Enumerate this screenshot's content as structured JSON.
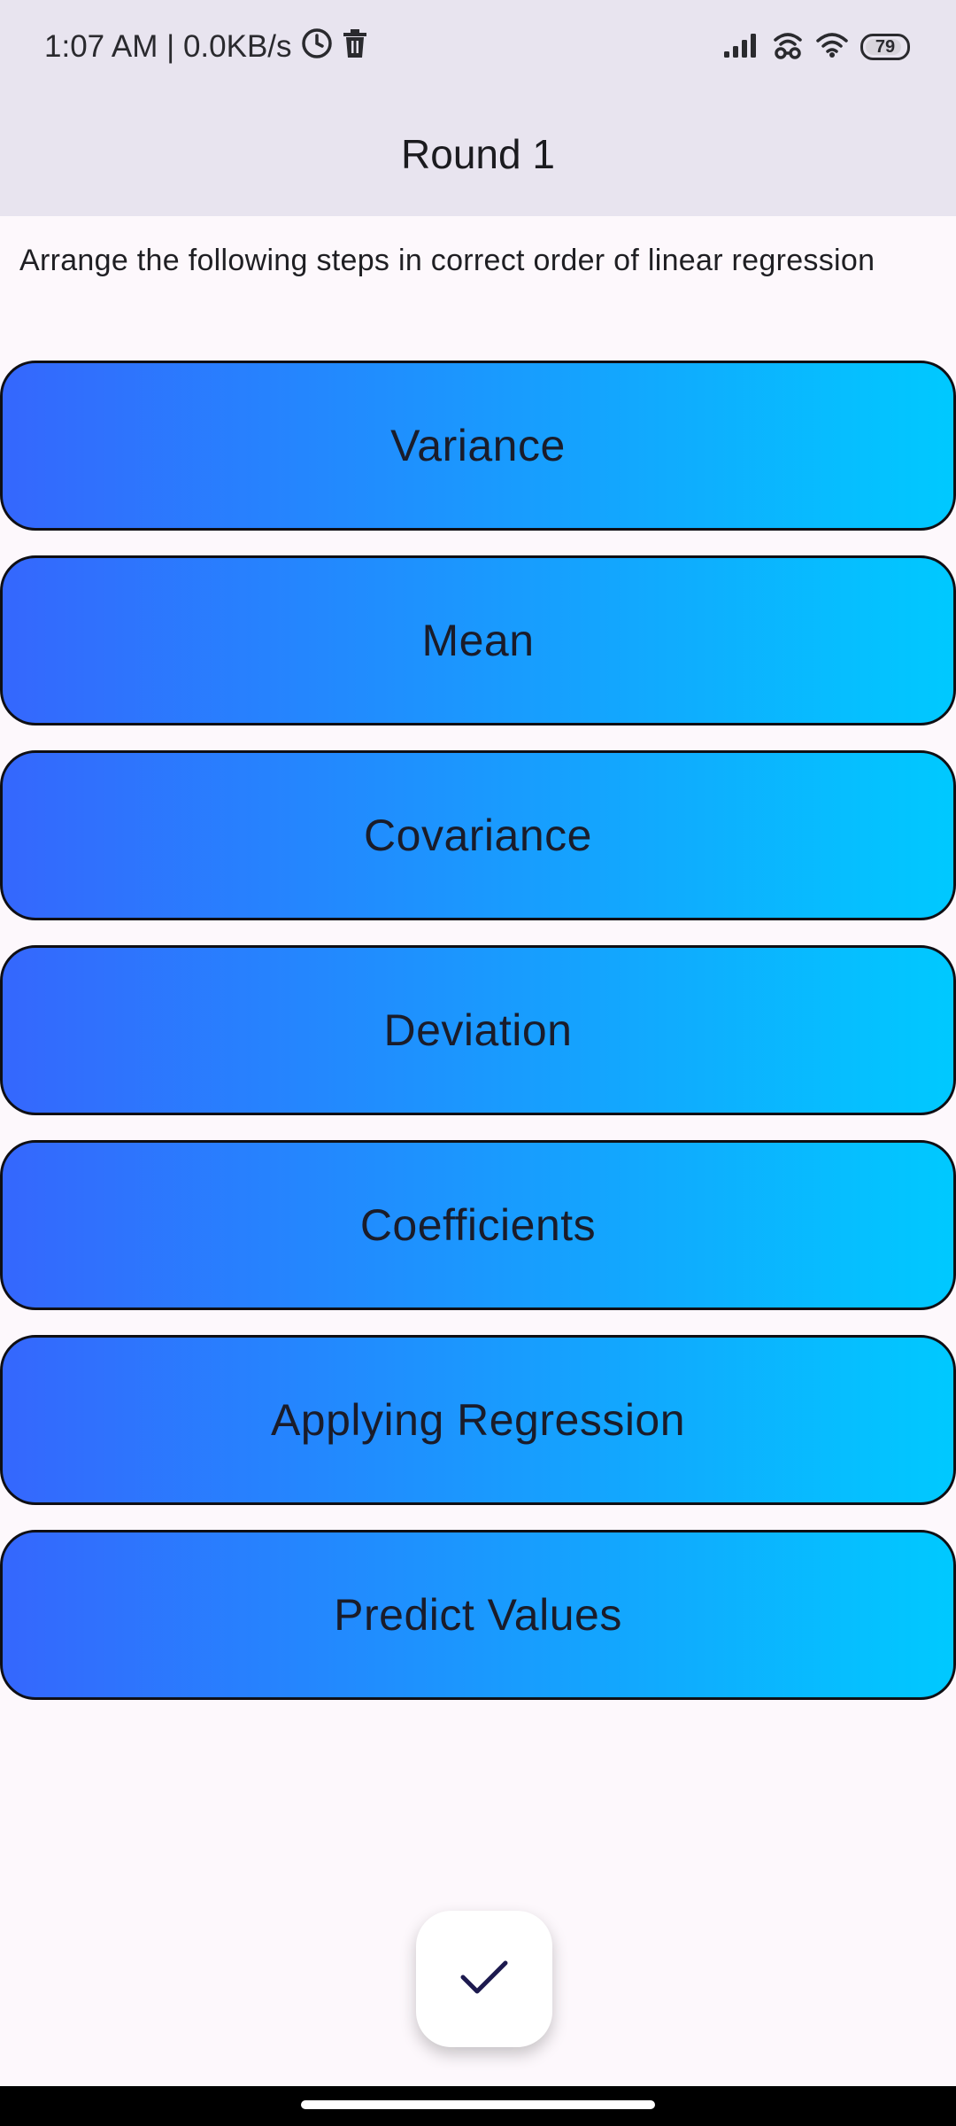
{
  "status_bar": {
    "time_speed": "1:07 AM | 0.0KB/s",
    "battery_level": "79",
    "icons": [
      "clock-icon",
      "trash-icon",
      "signal-icon",
      "hotspot-icon",
      "wifi-icon",
      "battery-icon"
    ]
  },
  "app_bar": {
    "title": "Round 1"
  },
  "question": {
    "text": "Arrange the following steps in correct order of linear regression"
  },
  "steps": [
    {
      "label": "Variance"
    },
    {
      "label": "Mean"
    },
    {
      "label": "Covariance"
    },
    {
      "label": "Deviation"
    },
    {
      "label": "Coefficients"
    },
    {
      "label": "Applying Regression"
    },
    {
      "label": "Predict Values"
    }
  ],
  "fab": {
    "icon": "check-icon"
  },
  "colors": {
    "gradient_start": "#3567fd",
    "gradient_end": "#00c9ff",
    "app_bar_bg": "#e8e4ef",
    "page_bg": "#fdf8fc",
    "check": "#1d1a4f"
  }
}
